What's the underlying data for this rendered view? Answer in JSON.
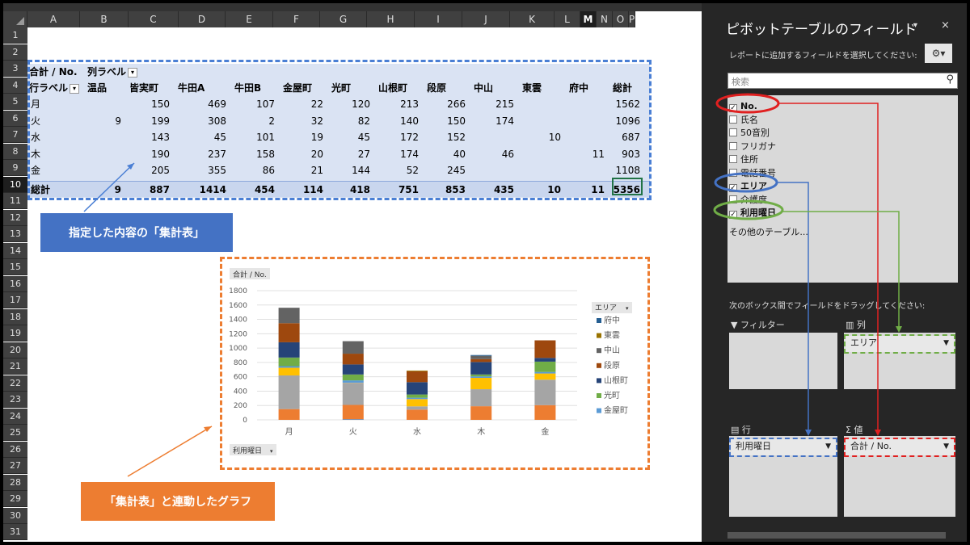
{
  "sheet": {
    "columns": [
      "A",
      "B",
      "C",
      "D",
      "E",
      "F",
      "G",
      "H",
      "I",
      "J",
      "K",
      "L",
      "M",
      "N",
      "O",
      "P"
    ],
    "rows": [
      "1",
      "2",
      "3",
      "4",
      "5",
      "6",
      "7",
      "8",
      "9",
      "10",
      "11",
      "12",
      "13",
      "14",
      "15",
      "16",
      "17",
      "18",
      "19",
      "20",
      "21",
      "22",
      "23",
      "24",
      "25",
      "26",
      "27",
      "28",
      "29",
      "30",
      "31"
    ],
    "selected_column": "M",
    "selected_row": "10"
  },
  "pivot": {
    "value_label": "合計 / No.",
    "col_label": "列ラベル",
    "row_label": "行ラベル",
    "headers": [
      "温品",
      "皆実町",
      "牛田A",
      "牛田B",
      "金屋町",
      "光町",
      "山根町",
      "段原",
      "中山",
      "東雲",
      "府中",
      "総計"
    ],
    "rows": [
      {
        "label": "月",
        "cells": [
          "",
          "150",
          "469",
          "107",
          "22",
          "120",
          "213",
          "266",
          "215",
          "",
          "",
          "1562"
        ]
      },
      {
        "label": "火",
        "cells": [
          "9",
          "199",
          "308",
          "2",
          "32",
          "82",
          "140",
          "150",
          "174",
          "",
          "",
          "1096"
        ]
      },
      {
        "label": "水",
        "cells": [
          "",
          "143",
          "45",
          "101",
          "19",
          "45",
          "172",
          "152",
          "",
          "10",
          "",
          "687"
        ]
      },
      {
        "label": "木",
        "cells": [
          "",
          "190",
          "237",
          "158",
          "20",
          "27",
          "174",
          "40",
          "46",
          "",
          "11",
          "903"
        ]
      },
      {
        "label": "金",
        "cells": [
          "",
          "205",
          "355",
          "86",
          "21",
          "144",
          "52",
          "245",
          "",
          "",
          "",
          "1108"
        ]
      }
    ],
    "total": {
      "label": "総計",
      "cells": [
        "9",
        "887",
        "1414",
        "454",
        "114",
        "418",
        "751",
        "853",
        "435",
        "10",
        "11",
        "5356"
      ]
    }
  },
  "callouts": {
    "table": "指定した内容の「集計表」",
    "graph": "「集計表」と連動したグラフ"
  },
  "chart_data": {
    "type": "bar",
    "stacked": true,
    "title": "合計 / No.",
    "categories": [
      "月",
      "火",
      "水",
      "木",
      "金"
    ],
    "ylim": [
      0,
      1800
    ],
    "yticks": [
      "0",
      "200",
      "400",
      "600",
      "800",
      "1000",
      "1200",
      "1400",
      "1600",
      "1800"
    ],
    "legend_title": "エリア",
    "axis_field": "利用曜日",
    "series": [
      {
        "name": "",
        "values": [
          0,
          9,
          0,
          0,
          0
        ],
        "color": "#4f81bd"
      },
      {
        "name": "",
        "values": [
          150,
          199,
          143,
          190,
          205
        ],
        "color": "#ed7d31"
      },
      {
        "name": "",
        "values": [
          469,
          308,
          45,
          237,
          355
        ],
        "color": "#a5a5a5"
      },
      {
        "name": "",
        "values": [
          107,
          2,
          101,
          158,
          86
        ],
        "color": "#ffc000"
      },
      {
        "name": "金屋町",
        "values": [
          22,
          32,
          19,
          20,
          21
        ],
        "color": "#5b9bd5"
      },
      {
        "name": "光町",
        "values": [
          120,
          82,
          45,
          27,
          144
        ],
        "color": "#70ad47"
      },
      {
        "name": "山根町",
        "values": [
          213,
          140,
          172,
          174,
          52
        ],
        "color": "#264478"
      },
      {
        "name": "段原",
        "values": [
          266,
          150,
          152,
          40,
          245
        ],
        "color": "#9e480e"
      },
      {
        "name": "中山",
        "values": [
          215,
          174,
          0,
          46,
          0
        ],
        "color": "#636363"
      },
      {
        "name": "東雲",
        "values": [
          0,
          0,
          10,
          0,
          0
        ],
        "color": "#997300"
      },
      {
        "name": "府中",
        "values": [
          0,
          0,
          0,
          11,
          0
        ],
        "color": "#255e91"
      }
    ],
    "legend": [
      "府中",
      "東雲",
      "中山",
      "段原",
      "山根町",
      "光町",
      "金屋町"
    ]
  },
  "panel": {
    "title": "ピボットテーブルのフィールド",
    "subtitle": "レポートに追加するフィールドを選択してください:",
    "search_placeholder": "検索",
    "fields": [
      {
        "label": "No.",
        "checked": true
      },
      {
        "label": "氏名",
        "checked": false
      },
      {
        "label": "50音別",
        "checked": false
      },
      {
        "label": "フリガナ",
        "checked": false
      },
      {
        "label": "住所",
        "checked": false
      },
      {
        "label": "電話番号",
        "checked": false
      },
      {
        "label": "エリア",
        "checked": true
      },
      {
        "label": "介護度",
        "checked": false
      },
      {
        "label": "利用曜日",
        "checked": true
      }
    ],
    "more_tables": "その他のテーブル...",
    "drag_hint": "次のボックス間でフィールドをドラッグしてください:",
    "filter_label": "フィルター",
    "columns_label": "列",
    "rows_label": "行",
    "values_label": "値",
    "columns_chip": "エリア",
    "rows_chip": "利用曜日",
    "values_chip": "合計 / No."
  }
}
